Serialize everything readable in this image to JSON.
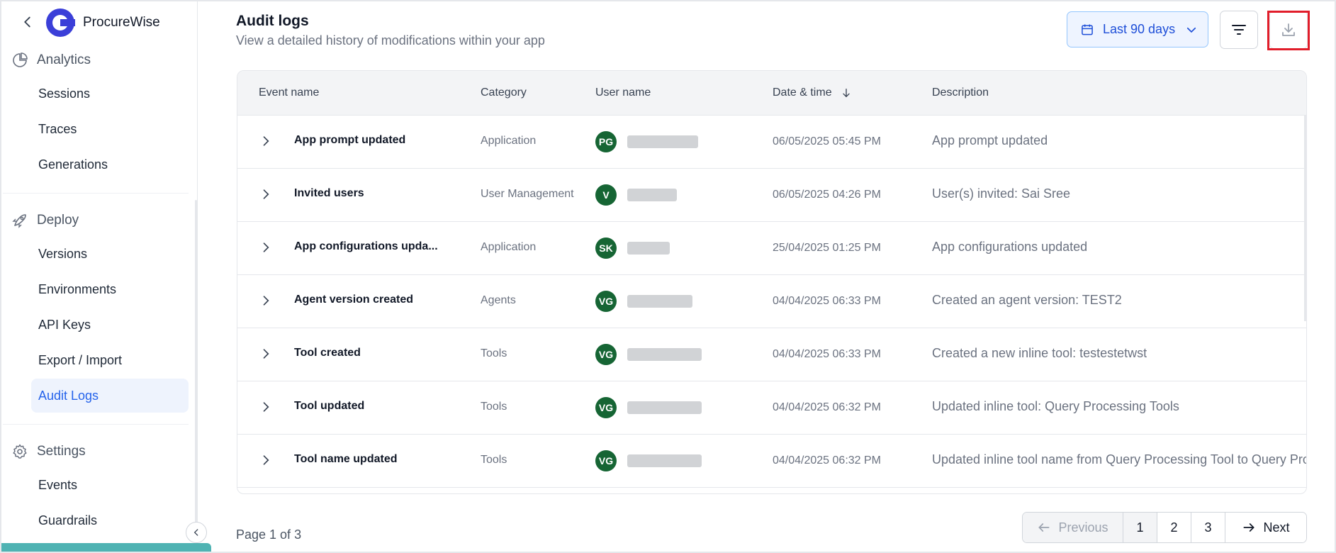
{
  "app": {
    "name": "ProcureWise"
  },
  "sidebar": {
    "sections": [
      {
        "label": "Analytics",
        "icon": "pie-chart-icon"
      },
      {
        "label": "Deploy",
        "icon": "rocket-icon"
      },
      {
        "label": "Settings",
        "icon": "gear-icon"
      }
    ],
    "items": [
      {
        "label": "Sessions"
      },
      {
        "label": "Traces"
      },
      {
        "label": "Generations"
      },
      {
        "label": "Versions"
      },
      {
        "label": "Environments"
      },
      {
        "label": "API Keys"
      },
      {
        "label": "Export / Import"
      },
      {
        "label": "Audit Logs",
        "active": true
      },
      {
        "label": "Events"
      },
      {
        "label": "Guardrails"
      }
    ]
  },
  "header": {
    "title": "Audit logs",
    "subtitle": "View a detailed history of modifications within your app",
    "date_filter": "Last 90 days"
  },
  "table": {
    "columns": [
      "Event name",
      "Category",
      "User name",
      "Date & time",
      "Description"
    ],
    "rows": [
      {
        "event": "App prompt updated",
        "category": "Application",
        "initials": "PG",
        "user": "",
        "datetime": "06/05/2025 05:45 PM",
        "description": "App prompt updated"
      },
      {
        "event": "Invited users",
        "category": "User Management",
        "initials": "V",
        "user": "",
        "datetime": "06/05/2025 04:26 PM",
        "description": "User(s) invited: Sai Sree"
      },
      {
        "event": "App configurations upda...",
        "category": "Application",
        "initials": "SK",
        "user": "",
        "datetime": "25/04/2025 01:25 PM",
        "description": "App configurations updated"
      },
      {
        "event": "Agent version created",
        "category": "Agents",
        "initials": "VG",
        "user": "",
        "datetime": "04/04/2025 06:33 PM",
        "description": "Created an agent version: TEST2"
      },
      {
        "event": "Tool created",
        "category": "Tools",
        "initials": "VG",
        "user": "",
        "datetime": "04/04/2025 06:33 PM",
        "description": "Created a new inline tool: testestetwst"
      },
      {
        "event": "Tool updated",
        "category": "Tools",
        "initials": "VG",
        "user": "",
        "datetime": "04/04/2025 06:32 PM",
        "description": "Updated inline tool: Query Processing Tools"
      },
      {
        "event": "Tool name updated",
        "category": "Tools",
        "initials": "VG",
        "user": "",
        "datetime": "04/04/2025 06:32 PM",
        "description": "Updated inline tool name from Query Processing Tool to Query Proc"
      }
    ]
  },
  "pagination": {
    "info": "Page 1 of 3",
    "previous": "Previous",
    "next": "Next",
    "pages": [
      "1",
      "2",
      "3"
    ],
    "current": 1
  },
  "colors": {
    "accent": "#2563eb",
    "avatar": "#166534",
    "highlight": "#e11d2a"
  }
}
